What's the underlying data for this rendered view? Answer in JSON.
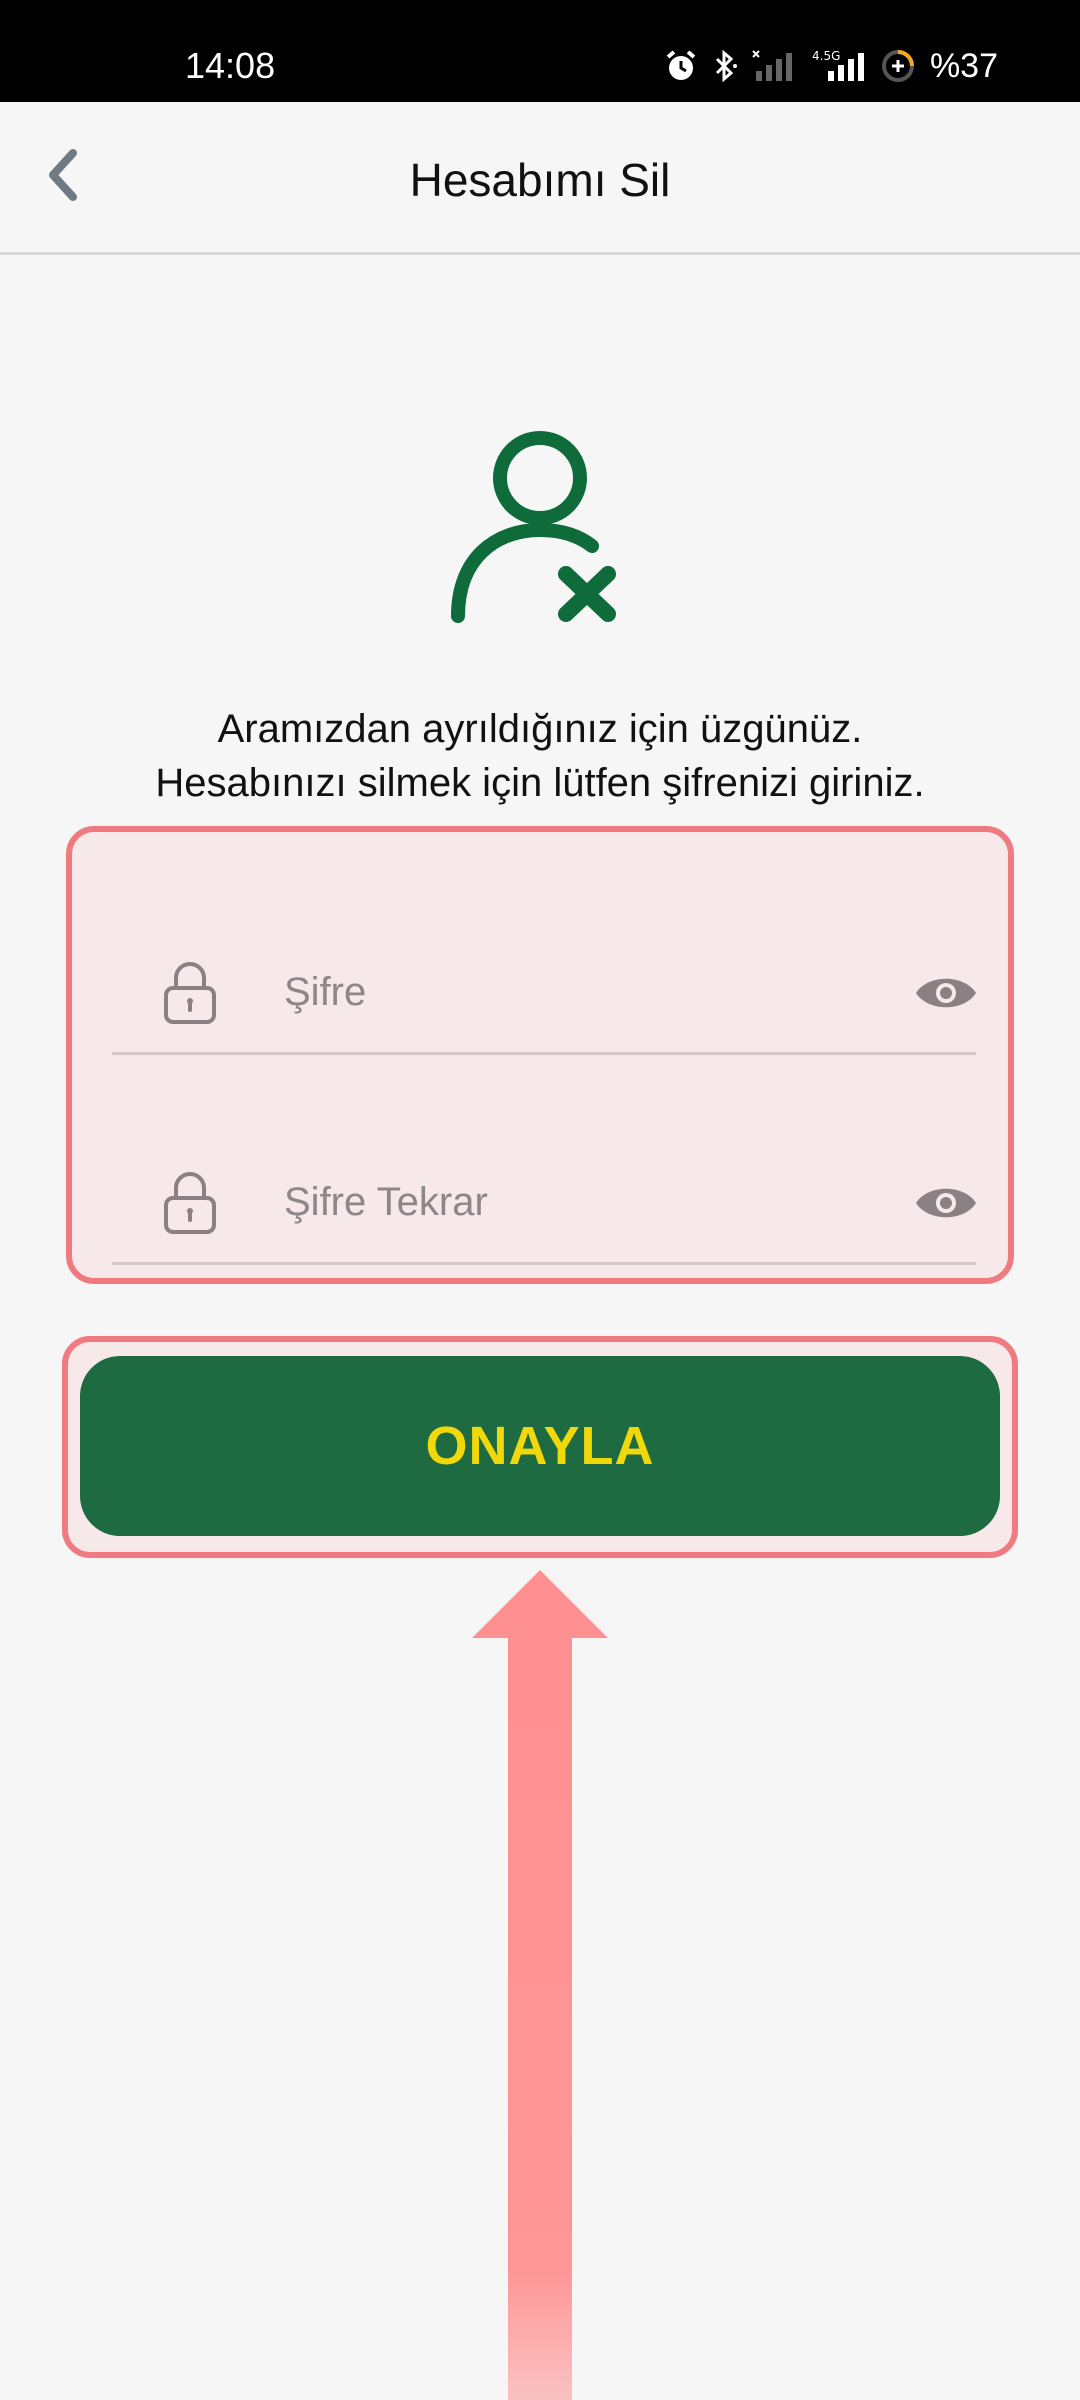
{
  "status_bar": {
    "time": "14:08",
    "battery": "%37",
    "icons": [
      "alarm-icon",
      "bluetooth-icon",
      "signal-icon",
      "4.5g-signal-icon",
      "battery-saver-icon"
    ]
  },
  "header": {
    "title": "Hesabımı Sil",
    "back_icon": "chevron-left-icon"
  },
  "message": {
    "line1": "Aramızdan ayrıldığınız için üzgünüz.",
    "line2": "Hesabınızı silmek için lütfen şifrenizi giriniz."
  },
  "form": {
    "password_placeholder": "Şifre",
    "password_repeat_placeholder": "Şifre Tekrar",
    "password_value": "",
    "password_repeat_value": ""
  },
  "actions": {
    "confirm_label": "ONAYLA"
  },
  "colors": {
    "primary": "#1e6b42",
    "button_text": "#f0d80a",
    "highlight": "#ef7b80"
  }
}
